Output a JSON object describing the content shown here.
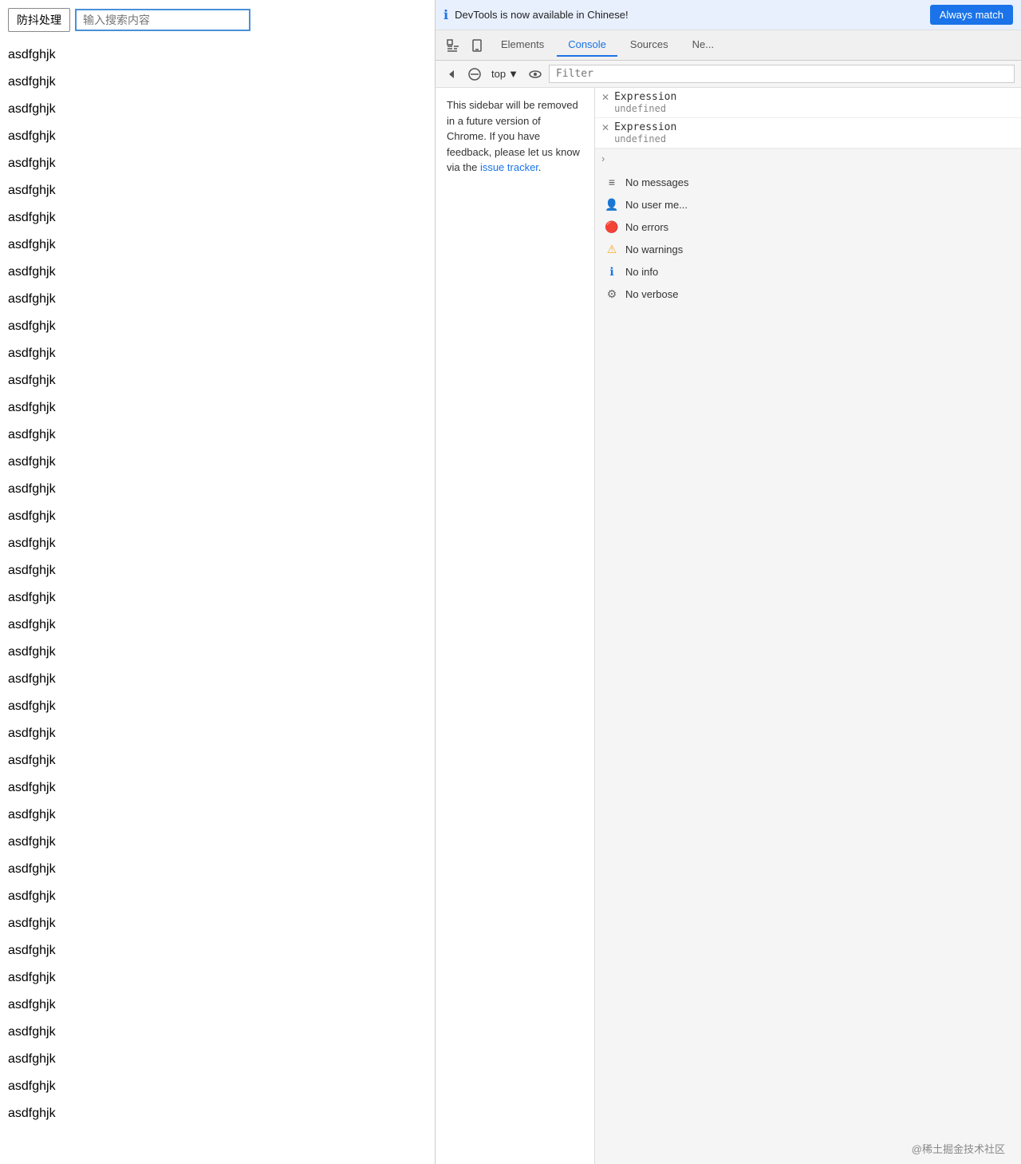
{
  "page": {
    "debounce_label": "防抖处理",
    "search_placeholder": "输入搜索内容",
    "list_items": [
      "asdfghjk",
      "asdfghjk",
      "asdfghjk",
      "asdfghjk",
      "asdfghjk",
      "asdfghjk",
      "asdfghjk",
      "asdfghjk",
      "asdfghjk",
      "asdfghjk",
      "asdfghjk",
      "asdfghjk",
      "asdfghjk",
      "asdfghjk",
      "asdfghjk",
      "asdfghjk",
      "asdfghjk",
      "asdfghjk",
      "asdfghjk",
      "asdfghjk",
      "asdfghjk",
      "asdfghjk",
      "asdfghjk",
      "asdfghjk",
      "asdfghjk",
      "asdfghjk",
      "asdfghjk",
      "asdfghjk",
      "asdfghjk",
      "asdfghjk",
      "asdfghjk",
      "asdfghjk",
      "asdfghjk",
      "asdfghjk",
      "asdfghjk",
      "asdfghjk",
      "asdfghjk",
      "asdfghjk",
      "asdfghjk",
      "asdfghjk"
    ]
  },
  "devtools": {
    "notification": {
      "text": "DevTools is now available in Chinese!",
      "button_label": "Always match"
    },
    "tabs": [
      "Elements",
      "Console",
      "Sources",
      "Ne..."
    ],
    "active_tab": "Console",
    "toolbar": {
      "context_label": "top",
      "filter_placeholder": "Filter"
    },
    "sidebar": {
      "message": "This sidebar will be removed in a future version of Chrome. If you have feedback, please let us know via the",
      "link_text": "issue tracker",
      "link_suffix": "."
    },
    "expressions": [
      {
        "name": "Expression",
        "value": "undefined"
      },
      {
        "name": "Expression",
        "value": "undefined"
      }
    ],
    "filters": [
      {
        "icon_type": "list",
        "label": "No messages"
      },
      {
        "icon_type": "user",
        "label": "No user me..."
      },
      {
        "icon_type": "error",
        "label": "No errors"
      },
      {
        "icon_type": "warning",
        "label": "No warnings"
      },
      {
        "icon_type": "info",
        "label": "No info"
      },
      {
        "icon_type": "verbose",
        "label": "No verbose"
      }
    ],
    "footer_text": "@稀土掘金技术社区"
  }
}
